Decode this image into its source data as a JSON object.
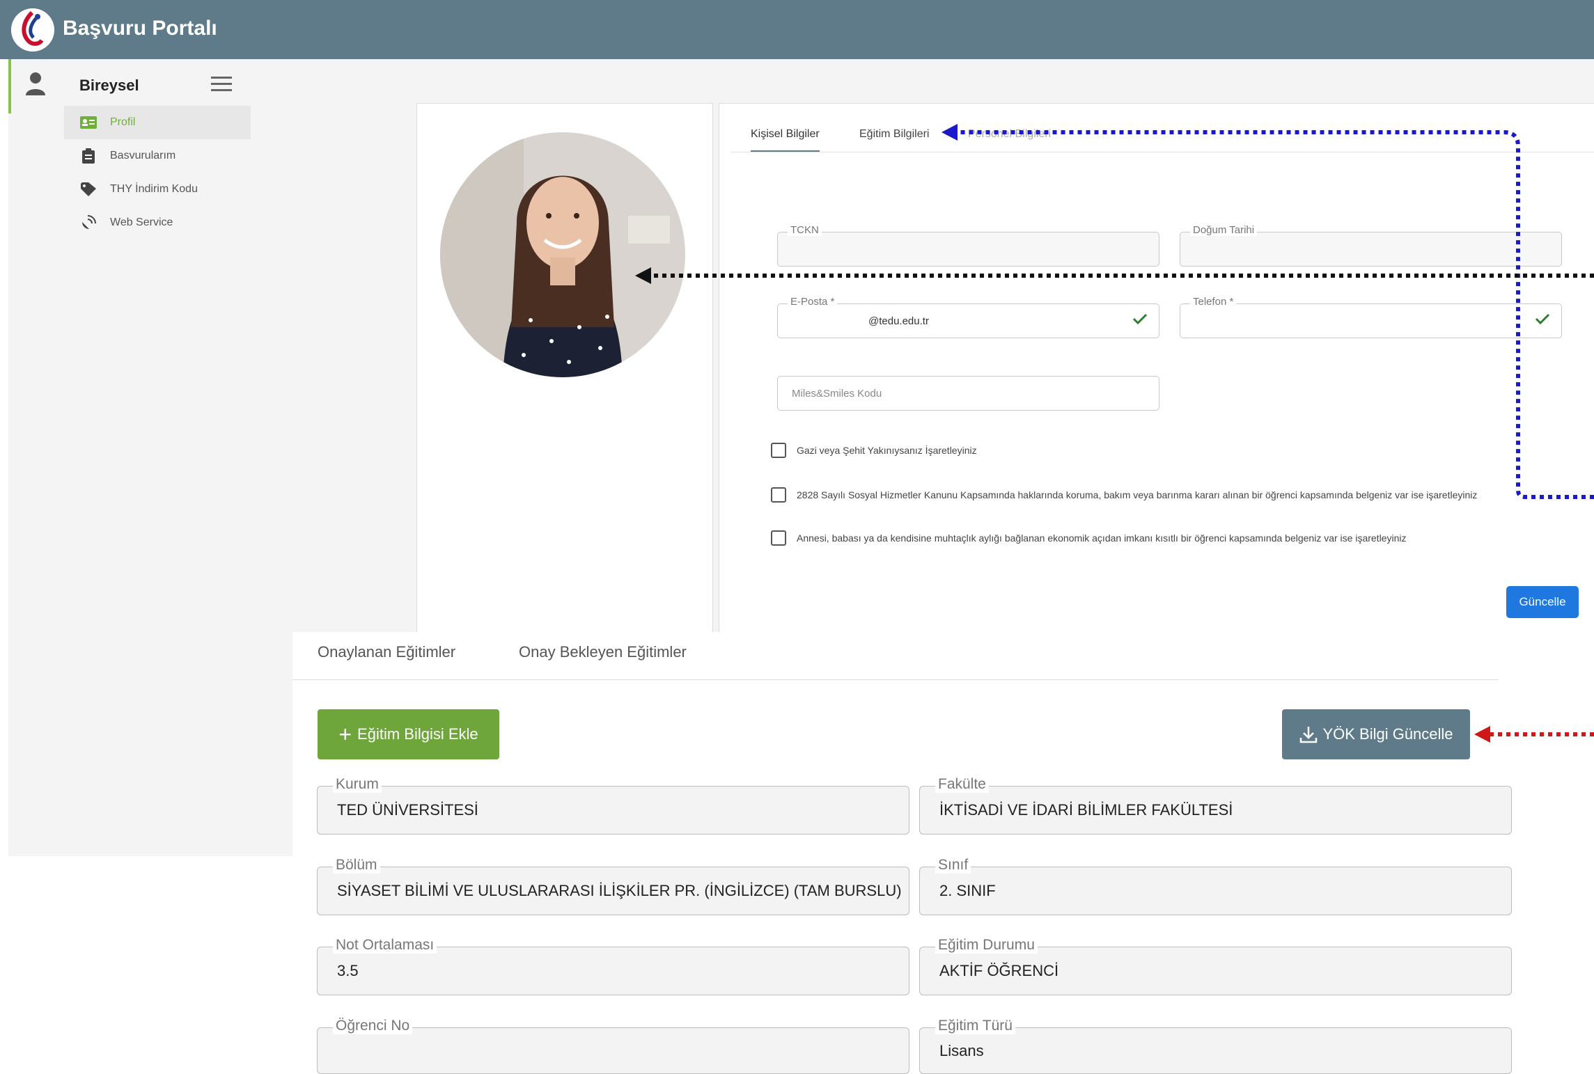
{
  "app": {
    "title": "Başvuru Portalı"
  },
  "sidebar": {
    "heading": "Bireysel",
    "items": [
      {
        "label": "Profil",
        "icon": "id-card-icon",
        "active": true
      },
      {
        "label": "Basvurularım",
        "icon": "clipboard-icon",
        "active": false
      },
      {
        "label": "THY İndirim Kodu",
        "icon": "tag-icon",
        "active": false
      },
      {
        "label": "Web Service",
        "icon": "satellite-dish-icon",
        "active": false
      }
    ]
  },
  "profile_tabs": [
    "Kişisel Bilgiler",
    "Eğitim Bilgileri",
    "Personel Bilgileri"
  ],
  "form": {
    "tckn_label": "TCKN",
    "dob_label": "Doğum Tarihi",
    "email_label": "E-Posta *",
    "email_value": "@tedu.edu.tr",
    "phone_label": "Telefon *",
    "miles_placeholder": "Miles&Smiles Kodu",
    "checkboxes": [
      "Gazi veya Şehit Yakınıysanız İşaretleyiniz",
      "2828 Sayılı Sosyal Hizmetler Kanunu Kapsamında haklarında koruma, bakım veya barınma kararı alınan bir öğrenci kapsamında belgeniz var ise işaretleyiniz",
      "Annesi, babası ya da kendisine muhtaçlık aylığı bağlanan ekonomik açıdan imkanı kısıtlı bir öğrenci kapsamında belgeniz var ise işaretleyiniz"
    ],
    "update_button": "Güncelle"
  },
  "education": {
    "tabs": [
      "Onaylanan Eğitimler",
      "Onay Bekleyen Eğitimler"
    ],
    "add_button": "Eğitim Bilgisi Ekle",
    "yok_button": "YÖK Bilgi Güncelle",
    "fields": {
      "kurum": {
        "label": "Kurum",
        "value": "TED ÜNİVERSİTESİ"
      },
      "fakulte": {
        "label": "Fakülte",
        "value": "İKTİSADİ VE İDARİ BİLİMLER FAKÜLTESİ"
      },
      "bolum": {
        "label": "Bölüm",
        "value": "SİYASET BİLİMİ VE ULUSLARARASI İLİŞKİLER PR. (İNGİLİZCE) (TAM BURSLU)"
      },
      "sinif": {
        "label": "Sınıf",
        "value": "2. SINIF"
      },
      "not": {
        "label": "Not Ortalaması",
        "value": "3.5"
      },
      "durum": {
        "label": "Eğitim Durumu",
        "value": "AKTİF ÖĞRENCİ"
      },
      "ogrenci_no": {
        "label": "Öğrenci No",
        "value": ""
      },
      "tur": {
        "label": "Eğitim Türü",
        "value": "Lisans"
      }
    }
  },
  "colors": {
    "header": "#5f7b8a",
    "accent_green": "#6ea63c",
    "primary_blue": "#1e78e0",
    "arrow_blue": "#1a1acc",
    "arrow_red": "#d01818"
  }
}
